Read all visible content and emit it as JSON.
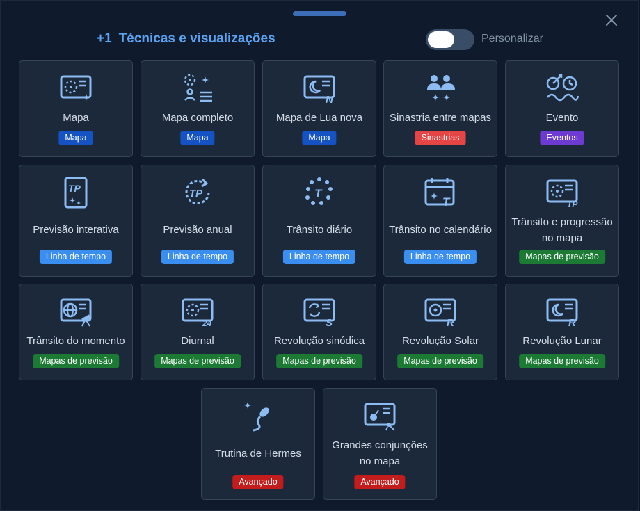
{
  "header": {
    "count": "+1",
    "title": "Técnicas e visualizações",
    "toggle_label": "Personalizar",
    "toggle_on": true
  },
  "colors": {
    "mapa": "#1553c4",
    "sinastrias": "#e64545",
    "eventos": "#6d3ad2",
    "linha_de_tempo": "#3a8ef0",
    "mapas_de_previsao": "#1c7a34",
    "avancado": "#c21c1c",
    "icon": "#8dbcf3"
  },
  "cards": [
    {
      "label": "Mapa",
      "badge": "Mapa",
      "badge_color": "#1553c4",
      "icon": "chart-sparkle-icon"
    },
    {
      "label": "Mapa completo",
      "badge": "Mapa",
      "badge_color": "#1553c4",
      "icon": "full-chart-icon"
    },
    {
      "label": "Mapa de Lua nova",
      "badge": "Mapa",
      "badge_color": "#1553c4",
      "icon": "new-moon-chart-icon",
      "glyph": "N"
    },
    {
      "label": "Sinastria entre mapas",
      "badge": "Sinastrias",
      "badge_color": "#e64545",
      "icon": "synastry-icon"
    },
    {
      "label": "Evento",
      "badge": "Eventos",
      "badge_color": "#6d3ad2",
      "icon": "event-icon"
    },
    {
      "label": "Previsão interativa",
      "badge": "Linha de tempo",
      "badge_color": "#3a8ef0",
      "icon": "tp-card-icon",
      "glyph": "TP"
    },
    {
      "label": "Previsão anual",
      "badge": "Linha de tempo",
      "badge_color": "#3a8ef0",
      "icon": "tp-cycle-icon",
      "glyph": "TP"
    },
    {
      "label": "Trânsito diário",
      "badge": "Linha de tempo",
      "badge_color": "#3a8ef0",
      "icon": "daily-transit-icon",
      "glyph": "T"
    },
    {
      "label": "Trânsito no calendário",
      "badge": "Linha de tempo",
      "badge_color": "#3a8ef0",
      "icon": "calendar-transit-icon",
      "glyph": "T"
    },
    {
      "label": "Trânsito e progressão no mapa",
      "badge": "Mapas de previsão",
      "badge_color": "#1c7a34",
      "icon": "chart-tp-icon",
      "glyph": "TP"
    },
    {
      "label": "Trânsito do momento",
      "badge": "Mapas de previsão",
      "badge_color": "#1c7a34",
      "icon": "globe-telescope-icon"
    },
    {
      "label": "Diurnal",
      "badge": "Mapas de previsão",
      "badge_color": "#1c7a34",
      "icon": "chart-24-icon",
      "glyph": "24"
    },
    {
      "label": "Revolução sinódica",
      "badge": "Mapas de previsão",
      "badge_color": "#1c7a34",
      "icon": "synodic-return-icon",
      "glyph": "S"
    },
    {
      "label": "Revolução Solar",
      "badge": "Mapas de previsão",
      "badge_color": "#1c7a34",
      "icon": "solar-return-icon",
      "glyph": "R"
    },
    {
      "label": "Revolução Lunar",
      "badge": "Mapas de previsão",
      "badge_color": "#1c7a34",
      "icon": "lunar-return-icon",
      "glyph": "R"
    },
    {
      "label": "Trutina de Hermes",
      "badge": "Avançado",
      "badge_color": "#c21c1c",
      "icon": "sperm-sparkle-icon"
    },
    {
      "label": "Grandes conjunções no mapa",
      "badge": "Avançado",
      "badge_color": "#c21c1c",
      "icon": "conjunction-chart-icon"
    }
  ]
}
